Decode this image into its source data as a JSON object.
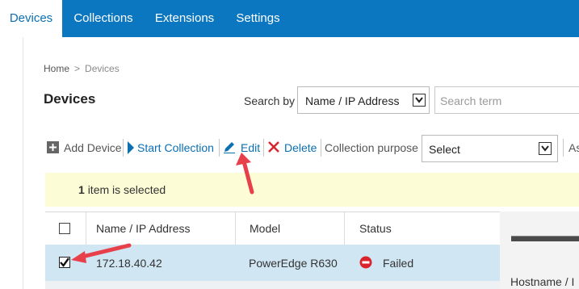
{
  "nav": {
    "tabs": [
      {
        "label": "Devices",
        "active": true
      },
      {
        "label": "Collections",
        "active": false
      },
      {
        "label": "Extensions",
        "active": false
      },
      {
        "label": "Settings",
        "active": false
      }
    ]
  },
  "breadcrumb": {
    "home": "Home",
    "separator": ">",
    "current": "Devices"
  },
  "page_title": "Devices",
  "search": {
    "label": "Search by",
    "field_value": "Name / IP Address",
    "placeholder": "Search term"
  },
  "toolbar": {
    "add_device": "Add Device",
    "start_collection": "Start Collection",
    "edit": "Edit",
    "delete": "Delete",
    "collection_purpose_label": "Collection purpose",
    "collection_purpose_value": "Select",
    "truncated_label": "As"
  },
  "selection": {
    "count": "1",
    "text": "item is selected"
  },
  "table": {
    "columns": [
      "Name / IP Address",
      "Model",
      "Status"
    ],
    "rows": [
      {
        "checked": true,
        "name": "172.18.40.42",
        "model": "PowerEdge R630",
        "status": "Failed"
      }
    ]
  },
  "detail": {
    "hostname_label": "Hostname / I"
  },
  "colors": {
    "nav_bg": "#0b77c0",
    "link": "#0b6fb2",
    "banner_bg": "#fcfcd6",
    "selected_row": "#d1e6f3",
    "failed_icon": "#d9232d",
    "annotation_arrow": "#e8404a"
  },
  "icons": [
    "plus-box-icon",
    "play-icon",
    "pencil-icon",
    "x-icon",
    "chevron-down-icon",
    "failed-status-icon",
    "checkmark-icon",
    "server-image"
  ]
}
